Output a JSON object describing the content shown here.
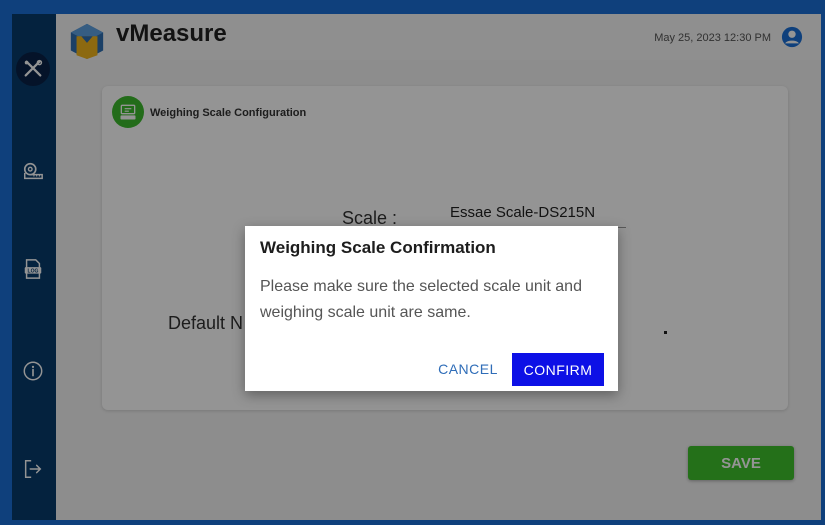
{
  "app": {
    "title": "vMeasure"
  },
  "header": {
    "datetime": "May 25, 2023 12:30 PM"
  },
  "sidebar": {
    "items": [
      {
        "icon": "tools-icon",
        "active": true
      },
      {
        "icon": "tape-measure-icon"
      },
      {
        "icon": "log-icon"
      },
      {
        "icon": "info-icon"
      },
      {
        "icon": "logout-icon"
      }
    ]
  },
  "card": {
    "title": "Weighing Scale Configuration",
    "scale_label": "Scale :",
    "scale_value": "Essae Scale-DS215N",
    "default_label": "Default N"
  },
  "save_label": "SAVE",
  "dialog": {
    "title": "Weighing Scale Confirmation",
    "message": "Please make sure the selected scale unit and weighing scale unit are same.",
    "cancel_label": "CANCEL",
    "confirm_label": "CONFIRM"
  },
  "colors": {
    "frame_blue": "#1a6fd6",
    "sidebar": "#073b6c",
    "save_green": "#3fc22c",
    "confirm_blue": "#0d10e6",
    "cancel_text": "#2f6db8"
  }
}
